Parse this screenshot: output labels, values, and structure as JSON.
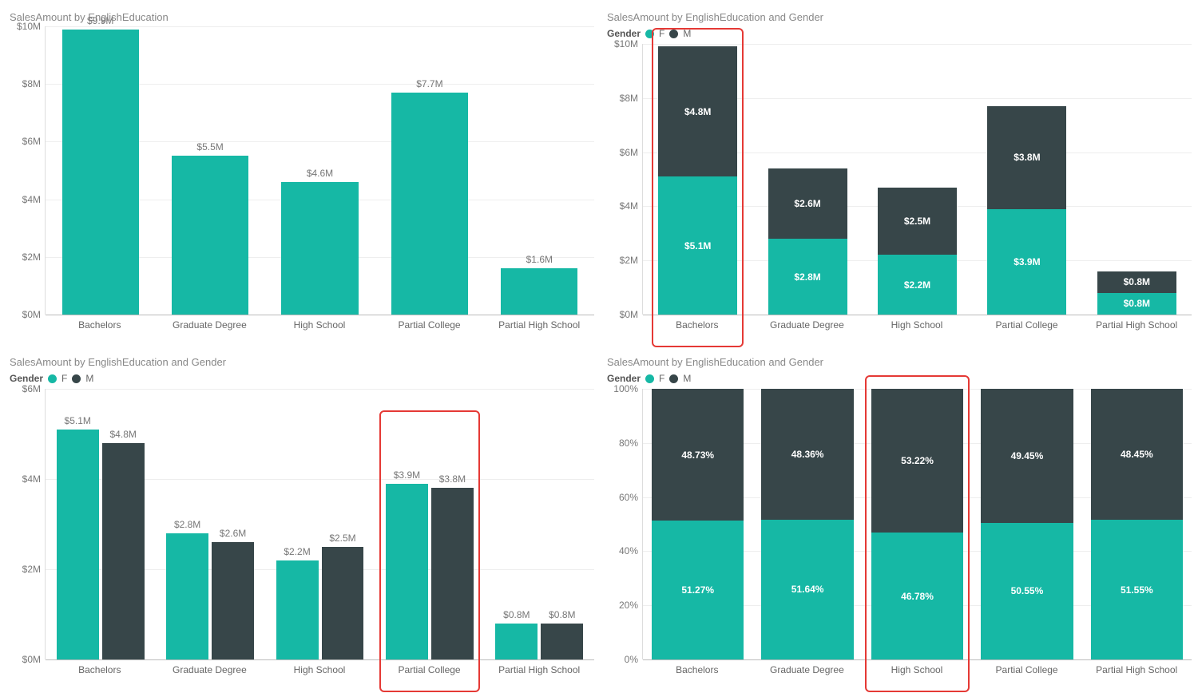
{
  "colors": {
    "f": "#16B8A5",
    "m": "#374649"
  },
  "chart_data": [
    {
      "id": "chart1",
      "type": "bar",
      "title": "SalesAmount by EnglishEducation",
      "categories": [
        "Bachelors",
        "Graduate Degree",
        "High School",
        "Partial College",
        "Partial High School"
      ],
      "values": [
        9.9,
        5.5,
        4.6,
        7.7,
        1.6
      ],
      "value_labels": [
        "$9.9M",
        "$5.5M",
        "$4.6M",
        "$7.7M",
        "$1.6M"
      ],
      "y_ticks": [
        0,
        2,
        4,
        6,
        8,
        10
      ],
      "y_tick_labels": [
        "$0M",
        "$2M",
        "$4M",
        "$6M",
        "$8M",
        "$10M"
      ],
      "ylim": [
        0,
        10
      ]
    },
    {
      "id": "chart2",
      "type": "stacked-bar",
      "title": "SalesAmount by EnglishEducation and Gender",
      "legend_title": "Gender",
      "categories": [
        "Bachelors",
        "Graduate Degree",
        "High School",
        "Partial College",
        "Partial High School"
      ],
      "series": [
        {
          "name": "F",
          "values": [
            5.1,
            2.8,
            2.2,
            3.9,
            0.8
          ],
          "labels": [
            "$5.1M",
            "$2.8M",
            "$2.2M",
            "$3.9M",
            "$0.8M"
          ]
        },
        {
          "name": "M",
          "values": [
            4.8,
            2.6,
            2.5,
            3.8,
            0.8
          ],
          "labels": [
            "$4.8M",
            "$2.6M",
            "$2.5M",
            "$3.8M",
            "$0.8M"
          ]
        }
      ],
      "y_ticks": [
        0,
        2,
        4,
        6,
        8,
        10
      ],
      "y_tick_labels": [
        "$0M",
        "$2M",
        "$4M",
        "$6M",
        "$8M",
        "$10M"
      ],
      "ylim": [
        0,
        10
      ],
      "highlight_index": 0
    },
    {
      "id": "chart3",
      "type": "grouped-bar",
      "title": "SalesAmount by EnglishEducation and Gender",
      "legend_title": "Gender",
      "categories": [
        "Bachelors",
        "Graduate Degree",
        "High School",
        "Partial College",
        "Partial High School"
      ],
      "series": [
        {
          "name": "F",
          "values": [
            5.1,
            2.8,
            2.2,
            3.9,
            0.8
          ],
          "labels": [
            "$5.1M",
            "$2.8M",
            "$2.2M",
            "$3.9M",
            "$0.8M"
          ]
        },
        {
          "name": "M",
          "values": [
            4.8,
            2.6,
            2.5,
            3.8,
            0.8
          ],
          "labels": [
            "$4.8M",
            "$2.6M",
            "$2.5M",
            "$3.8M",
            "$0.8M"
          ]
        }
      ],
      "y_ticks": [
        0,
        2,
        4,
        6
      ],
      "y_tick_labels": [
        "$0M",
        "$2M",
        "$4M",
        "$6M"
      ],
      "ylim": [
        0,
        6
      ],
      "highlight_index": 3
    },
    {
      "id": "chart4",
      "type": "stacked-bar-100",
      "title": "SalesAmount by EnglishEducation and Gender",
      "legend_title": "Gender",
      "categories": [
        "Bachelors",
        "Graduate Degree",
        "High School",
        "Partial College",
        "Partial High School"
      ],
      "series": [
        {
          "name": "F",
          "values": [
            51.27,
            51.64,
            46.78,
            50.55,
            51.55
          ],
          "labels": [
            "51.27%",
            "51.64%",
            "46.78%",
            "50.55%",
            "51.55%"
          ]
        },
        {
          "name": "M",
          "values": [
            48.73,
            48.36,
            53.22,
            49.45,
            48.45
          ],
          "labels": [
            "48.73%",
            "48.36%",
            "53.22%",
            "49.45%",
            "48.45%"
          ]
        }
      ],
      "y_ticks": [
        0,
        20,
        40,
        60,
        80,
        100
      ],
      "y_tick_labels": [
        "0%",
        "20%",
        "40%",
        "60%",
        "80%",
        "100%"
      ],
      "ylim": [
        0,
        100
      ],
      "highlight_index": 2
    }
  ]
}
